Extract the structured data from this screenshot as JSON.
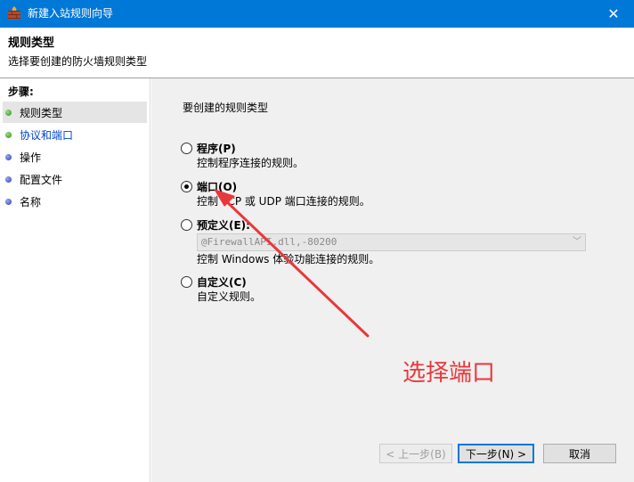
{
  "window": {
    "title": "新建入站规则向导",
    "close_symbol": "✕"
  },
  "header": {
    "title": "规则类型",
    "subtitle": "选择要创建的防火墙规则类型"
  },
  "steps": {
    "label": "步骤:",
    "items": [
      {
        "label": "规则类型",
        "dot": "green",
        "active": true,
        "link": false
      },
      {
        "label": "协议和端口",
        "dot": "green",
        "active": false,
        "link": true
      },
      {
        "label": "操作",
        "dot": "blue",
        "active": false,
        "link": false
      },
      {
        "label": "配置文件",
        "dot": "blue",
        "active": false,
        "link": false
      },
      {
        "label": "名称",
        "dot": "blue",
        "active": false,
        "link": false
      }
    ]
  },
  "main": {
    "prompt": "要创建的规则类型",
    "options": [
      {
        "title": "程序(P)",
        "desc": "控制程序连接的规则。",
        "checked": false
      },
      {
        "title": "端口(O)",
        "desc": "控制 TCP 或 UDP 端口连接的规则。",
        "checked": true
      },
      {
        "title": "预定义(E):",
        "desc": "控制 Windows 体验功能连接的规则。",
        "checked": false
      },
      {
        "title": "自定义(C)",
        "desc": "自定义规则。",
        "checked": false
      }
    ],
    "predefined_value": "@FirewallAPI.dll,-80200"
  },
  "buttons": {
    "back": "< 上一步(B)",
    "next": "下一步(N) >",
    "cancel": "取消"
  },
  "annotation": {
    "text": "选择端口",
    "color": "#e8383b"
  },
  "colors": {
    "titlebar": "#0078d7",
    "accent": "#0078d7"
  }
}
